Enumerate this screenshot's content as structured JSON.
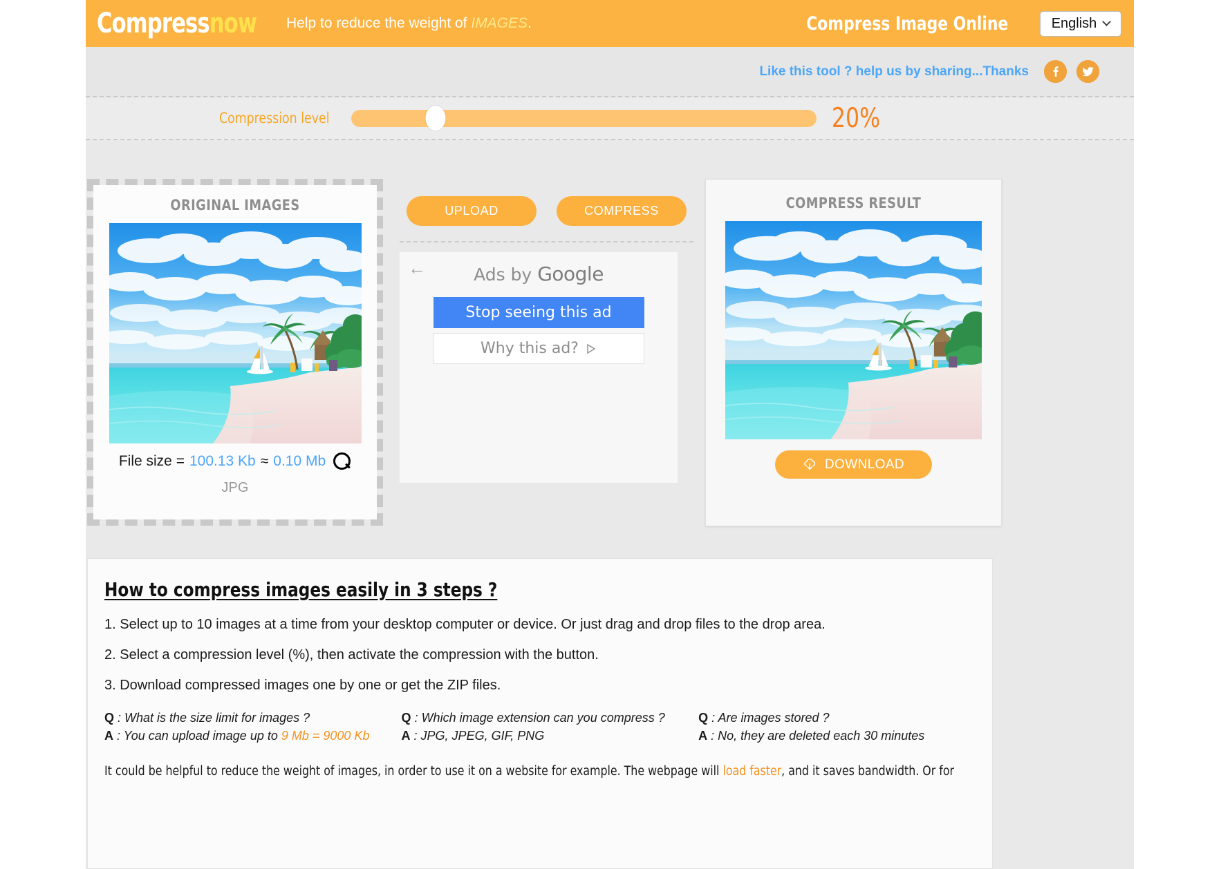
{
  "header": {
    "logo_part1": "Compress",
    "logo_part2": "now",
    "tagline_prefix": "Help to reduce the weight of ",
    "tagline_em": "IMAGES",
    "tagline_suffix": ".",
    "title": "Compress Image Online",
    "language": "English",
    "chevron_icon": "chevron-down-icon"
  },
  "share": {
    "text": "Like this tool ? help us by sharing...Thanks",
    "facebook_icon": "facebook-icon",
    "twitter_icon": "twitter-icon"
  },
  "compression": {
    "label": "Compression level",
    "value": "20%",
    "percent": 20,
    "slider_min": 0,
    "slider_max": 100
  },
  "original": {
    "title": "ORIGINAL IMAGES",
    "filesize_label": "File size = ",
    "filesize_kb": "100.13 Kb",
    "approx": "≈",
    "filesize_mb": "0.10 Mb",
    "zoom_icon": "magnifier-icon",
    "filetype": "JPG",
    "image_alt": "tropical-beach-photo"
  },
  "actions": {
    "upload_label": "UPLOAD",
    "compress_label": "COMPRESS"
  },
  "ad": {
    "back_icon": "back-arrow-icon",
    "ads_by_prefix": "Ads by ",
    "ads_by_brand": "Google",
    "stop_label": "Stop seeing this ad",
    "why_label": "Why this ad?",
    "why_icon": "adchoices-icon"
  },
  "result": {
    "title": "COMPRESS RESULT",
    "download_label": "DOWNLOAD",
    "download_icon": "cloud-download-icon",
    "image_alt": "tropical-beach-photo-compressed"
  },
  "howto": {
    "heading": "How to compress images easily in 3 steps ?",
    "steps": [
      "1. Select up to 10 images at a time from your desktop computer or device. Or just drag and drop files to the drop area.",
      "2. Select a compression level (%), then activate the compression with the button.",
      "3. Download compressed images one by one or get the ZIP files."
    ],
    "faq": [
      {
        "q_key": "Q",
        "q_text": " : What is the size limit for images ?",
        "a_key": "A",
        "a_text": " : You can upload image up to ",
        "a_highlight": "9 Mb = 9000 Kb",
        "a_tail": ""
      },
      {
        "q_key": "Q",
        "q_text": " : Which image extension can you compress ?",
        "a_key": "A",
        "a_text": " : JPG, JPEG, GIF, PNG",
        "a_highlight": "",
        "a_tail": ""
      },
      {
        "q_key": "Q",
        "q_text": " : Are images stored ?",
        "a_key": "A",
        "a_text": " : No, they are deleted each 30 minutes",
        "a_highlight": "",
        "a_tail": ""
      }
    ],
    "outro_before": "It could be helpful to reduce the weight of images, in order to use it on a website for example. The webpage will ",
    "outro_link": "load faster",
    "outro_after": ", and it saves bandwidth. Or for"
  },
  "colors": {
    "brand_orange": "#fcb341",
    "button_orange": "#fcb03e",
    "slider_fill": "#ffc471",
    "accent_text": "#f58220",
    "link_blue": "#4da6f7",
    "ad_blue": "#4285f4",
    "page_bg": "#e9e9e9"
  }
}
